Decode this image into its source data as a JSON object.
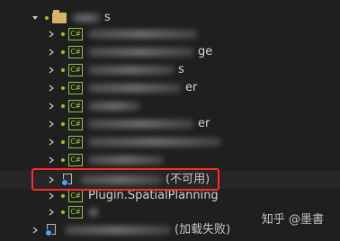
{
  "solution_explorer": {
    "folder": {
      "label": "s",
      "icon": "folder-icon",
      "expanded": true
    },
    "projects": [
      {
        "label": "",
        "icon": "csharp-project-icon",
        "collapsed": true
      },
      {
        "label": "ge",
        "icon": "csharp-project-icon",
        "collapsed": true
      },
      {
        "label": "s",
        "icon": "csharp-project-icon",
        "collapsed": true
      },
      {
        "label": "er",
        "icon": "csharp-project-icon",
        "collapsed": true
      },
      {
        "label": "",
        "icon": "csharp-project-icon",
        "collapsed": true
      },
      {
        "label": "er",
        "icon": "csharp-project-icon",
        "collapsed": true
      },
      {
        "label": "",
        "icon": "csharp-project-icon",
        "collapsed": true
      },
      {
        "label": "",
        "icon": "csharp-project-icon",
        "collapsed": true
      },
      {
        "label": "",
        "icon": "csharp-project-icon",
        "collapsed": true
      }
    ],
    "unavailable_project": {
      "label": "(不可用)",
      "icon": "unavailable-project-icon"
    },
    "plugin_project": {
      "label": "Plugin.SpatialPlanning",
      "icon": "csharp-project-icon"
    },
    "last_project": {
      "label": "",
      "icon": "csharp-project-icon"
    },
    "failed_project": {
      "label": "(加载失败)",
      "icon": "failed-project-icon"
    }
  },
  "watermark": "知乎 @墨書",
  "colors": {
    "background": "#1f1f1f",
    "highlight": "#ff2a2a",
    "csharp_icon": "#8dc63f",
    "folder": "#d7b36a"
  }
}
